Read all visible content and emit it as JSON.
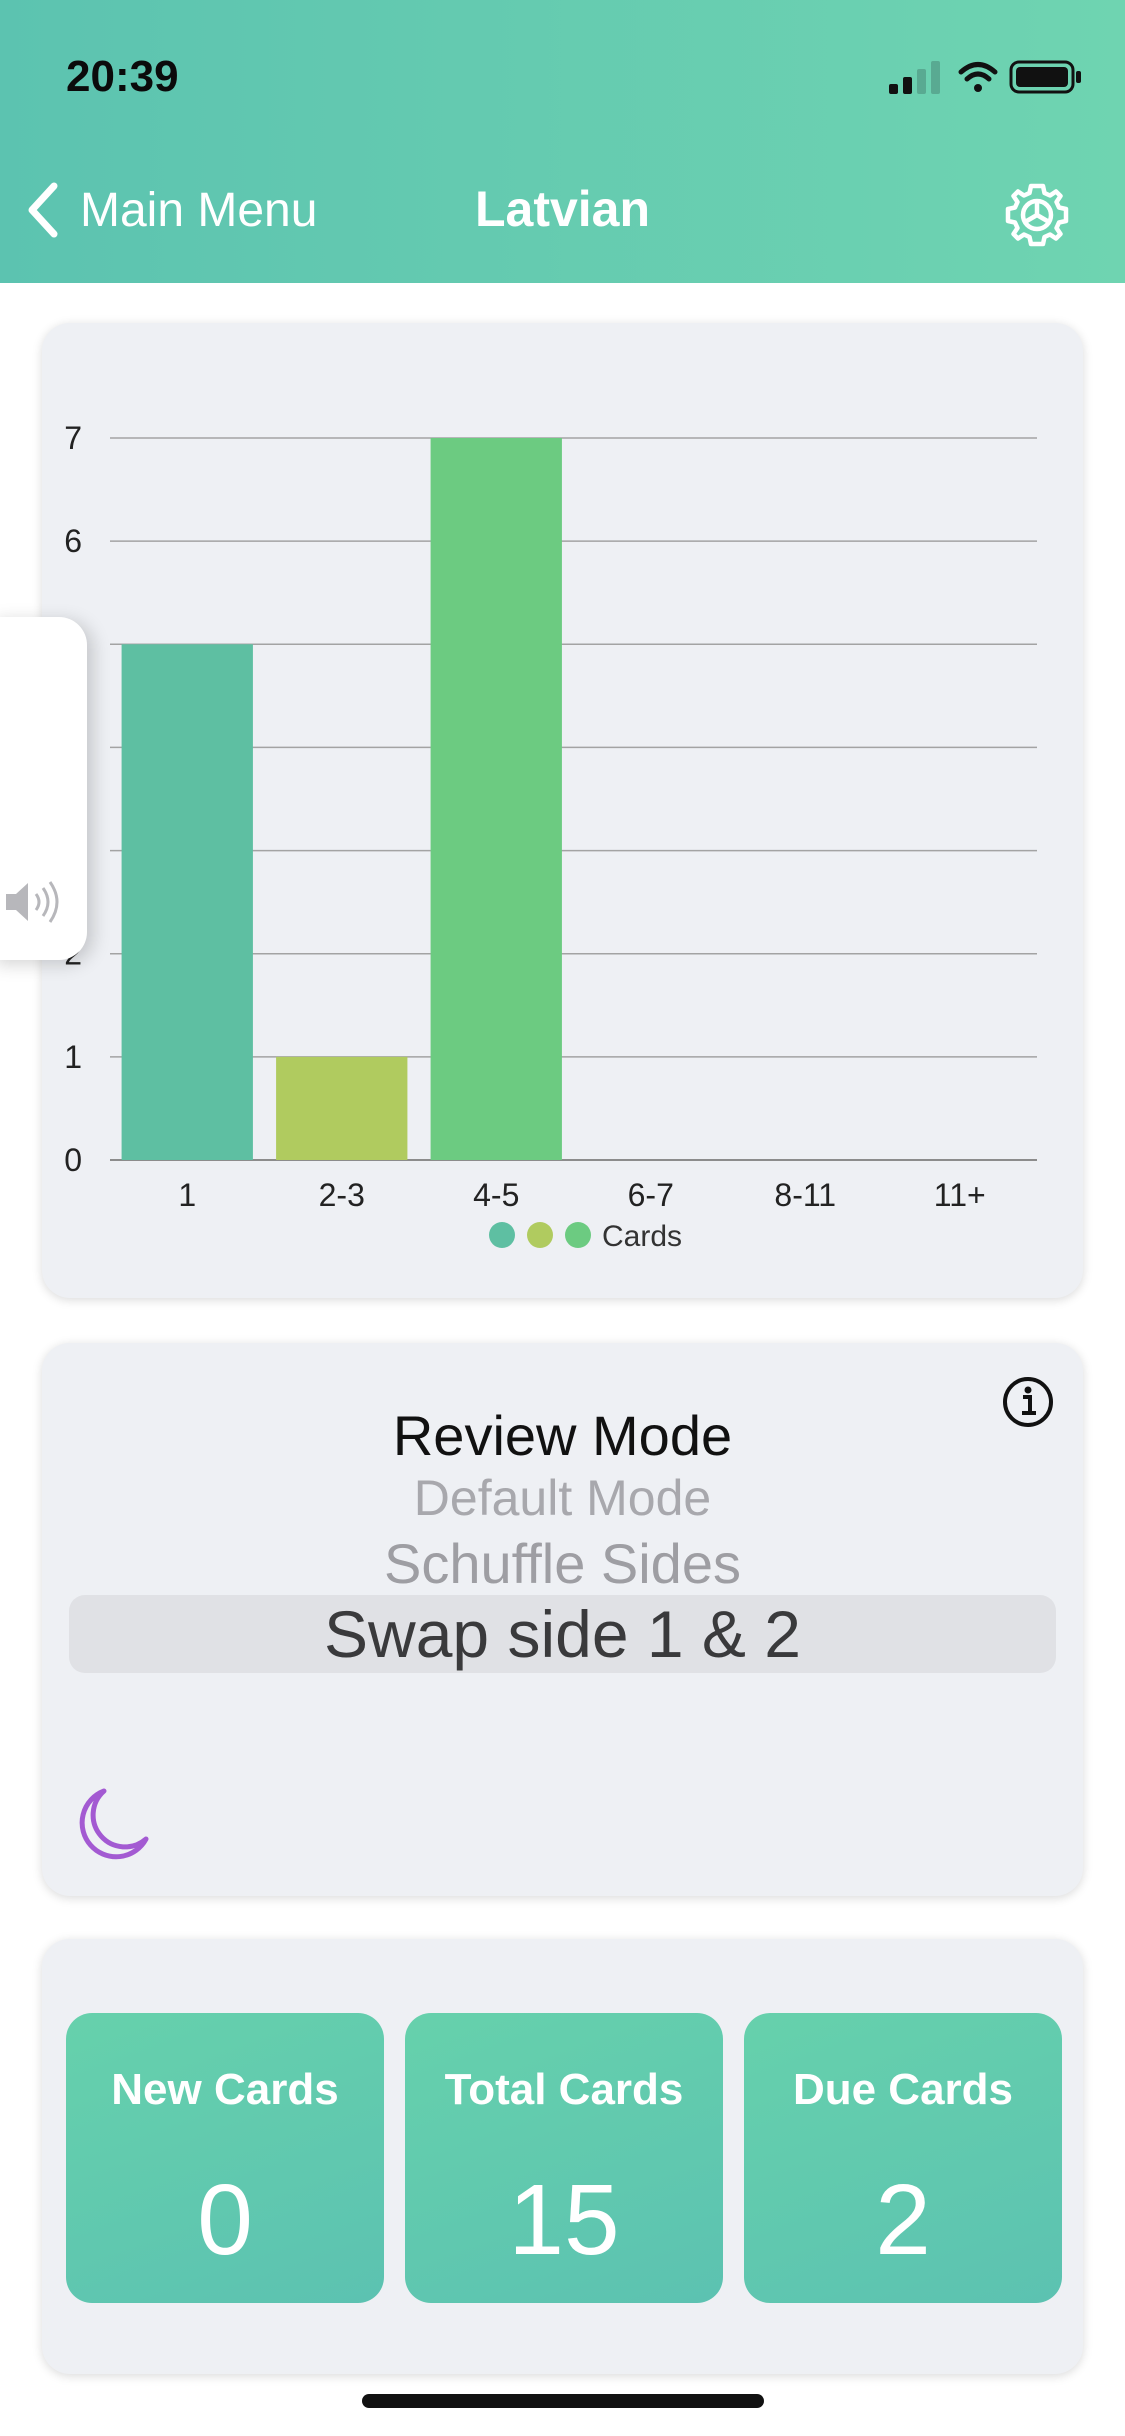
{
  "status_bar": {
    "time": "20:39"
  },
  "nav": {
    "back_label": "Main Menu",
    "title": "Latvian"
  },
  "colors": {
    "accent": "#6fd4b1",
    "bar1": "#5ebfa2",
    "bar2": "#b0cb5f",
    "bar3": "#6ccb81",
    "moon": "#a35ad2"
  },
  "chart_data": {
    "type": "bar",
    "categories": [
      "1",
      "2-3",
      "4-5",
      "6-7",
      "8-11",
      "11+"
    ],
    "values": [
      5,
      1,
      7,
      0,
      0,
      0
    ],
    "bar_colors": [
      "#5ebfa2",
      "#b0cb5f",
      "#6ccb81"
    ],
    "ylim": [
      0,
      7
    ],
    "yticks": [
      "0",
      "1",
      "2",
      "3",
      "4",
      "5",
      "6",
      "7"
    ],
    "grid": true,
    "legend": {
      "position": "bottom",
      "label": "Cards"
    }
  },
  "review": {
    "title": "Review Mode",
    "options": [
      "Default Mode",
      "Schuffle Sides",
      "Swap side 1 & 2"
    ],
    "selected": "Swap side 1 & 2"
  },
  "stats": [
    {
      "label": "New Cards",
      "value": "0"
    },
    {
      "label": "Total Cards",
      "value": "15"
    },
    {
      "label": "Due Cards",
      "value": "2"
    }
  ],
  "icons": {
    "back": "chevron-left-icon",
    "settings": "gear-icon",
    "info": "info-icon",
    "moon": "moon-icon",
    "speaker": "speaker-icon"
  }
}
